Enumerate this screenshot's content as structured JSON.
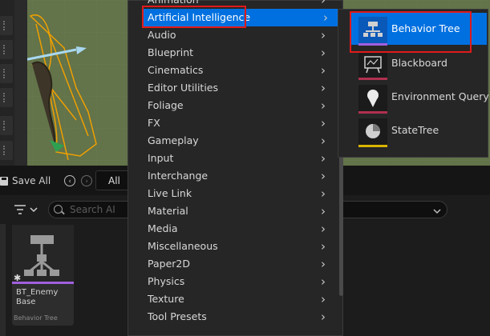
{
  "toolbar": {
    "save_all": "Save All",
    "breadcrumb": "All"
  },
  "search": {
    "placeholder": "Search AI"
  },
  "asset": {
    "name": "BT_Enemy\nBase",
    "type": "Behavior Tree",
    "color": "#a05fe0"
  },
  "menu": {
    "items": [
      {
        "label": "Animation"
      },
      {
        "label": "Artificial Intelligence",
        "selected": true
      },
      {
        "label": "Audio"
      },
      {
        "label": "Blueprint"
      },
      {
        "label": "Cinematics"
      },
      {
        "label": "Editor Utilities"
      },
      {
        "label": "Foliage"
      },
      {
        "label": "FX"
      },
      {
        "label": "Gameplay"
      },
      {
        "label": "Input"
      },
      {
        "label": "Interchange"
      },
      {
        "label": "Live Link"
      },
      {
        "label": "Material"
      },
      {
        "label": "Media"
      },
      {
        "label": "Miscellaneous"
      },
      {
        "label": "Paper2D"
      },
      {
        "label": "Physics"
      },
      {
        "label": "Texture"
      },
      {
        "label": "Tool Presets"
      }
    ]
  },
  "submenu": {
    "items": [
      {
        "label": "Behavior Tree",
        "icon": "behavior-tree-icon",
        "color": "#a05fe0"
      },
      {
        "label": "Blackboard",
        "icon": "blackboard-icon",
        "color": "#b03050"
      },
      {
        "label": "Environment Query",
        "icon": "environment-query-icon",
        "color": "#b03050"
      },
      {
        "label": "StateTree",
        "icon": "state-tree-icon",
        "color": "#d8b400"
      }
    ]
  },
  "colors": {
    "selection": "#0070e0",
    "highlight": "#e01a1a"
  }
}
